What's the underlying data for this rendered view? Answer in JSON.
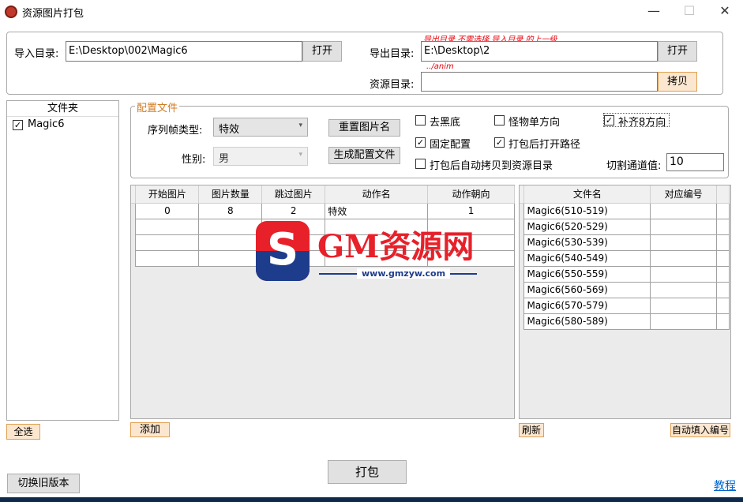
{
  "window": {
    "title": "资源图片打包",
    "minimize": "—",
    "maximize": "☐",
    "close": "✕"
  },
  "paths": {
    "import_label": "导入目录:",
    "import_value": "E:\\Desktop\\002\\Magic6",
    "import_button": "打开",
    "export_label": "导出目录:",
    "export_value": "E:\\Desktop\\2",
    "export_button": "打开",
    "export_hint": "导出目录 不需选择 导入目录 的上一级",
    "resource_label": "资源目录:",
    "resource_value": "",
    "resource_hint": "../anim",
    "copy_button": "拷贝"
  },
  "folders": {
    "header": "文件夹",
    "items": [
      {
        "label": "Magic6",
        "checked": true
      }
    ],
    "select_all": "全选"
  },
  "config": {
    "group_label": "配置文件",
    "frame_type_label": "序列帧类型:",
    "frame_type_value": "特效",
    "gender_label": "性别:",
    "gender_value": "男",
    "reset_button": "重置图片名",
    "generate_button": "生成配置文件",
    "cut_label": "切割通道值:",
    "cut_value": "10",
    "options": [
      {
        "label": "去黑底",
        "checked": false
      },
      {
        "label": "怪物单方向",
        "checked": false
      },
      {
        "label": "补齐8方向",
        "checked": true
      },
      {
        "label": "固定配置",
        "checked": true
      },
      {
        "label": "打包后打开路径",
        "checked": true
      },
      {
        "label": "打包后自动拷贝到资源目录",
        "checked": false
      }
    ]
  },
  "actions_table": {
    "columns": [
      "开始图片",
      "图片数量",
      "跳过图片",
      "动作名",
      "动作朝向"
    ],
    "rows": [
      [
        "0",
        "8",
        "2",
        "特效",
        "1"
      ],
      [
        "",
        "",
        "",
        "",
        ""
      ],
      [
        "",
        "",
        "",
        "",
        ""
      ],
      [
        "",
        "",
        "",
        "",
        ""
      ]
    ],
    "add_button": "添加"
  },
  "files_table": {
    "columns": [
      "文件名",
      "对应编号"
    ],
    "rows": [
      [
        "Magic6(510-519)",
        ""
      ],
      [
        "Magic6(520-529)",
        ""
      ],
      [
        "Magic6(530-539)",
        ""
      ],
      [
        "Magic6(540-549)",
        ""
      ],
      [
        "Magic6(550-559)",
        ""
      ],
      [
        "Magic6(560-569)",
        ""
      ],
      [
        "Magic6(570-579)",
        ""
      ],
      [
        "Magic6(580-589)",
        ""
      ]
    ],
    "refresh_button": "刷新",
    "auto_fill_button": "自动填入编号"
  },
  "footer": {
    "pack_button": "打包",
    "switch_button": "切换旧版本",
    "tutorial_link": "教程"
  },
  "watermark": {
    "logo_letter": "S",
    "text": "GM资源网",
    "url": "www.gmzyw.com"
  },
  "colors": {
    "accent_orange": "#e0a050",
    "hint_red": "#e8000b",
    "link_blue": "#0066cc",
    "watermark_red": "#e8202a",
    "watermark_blue": "#1e3c8c"
  }
}
